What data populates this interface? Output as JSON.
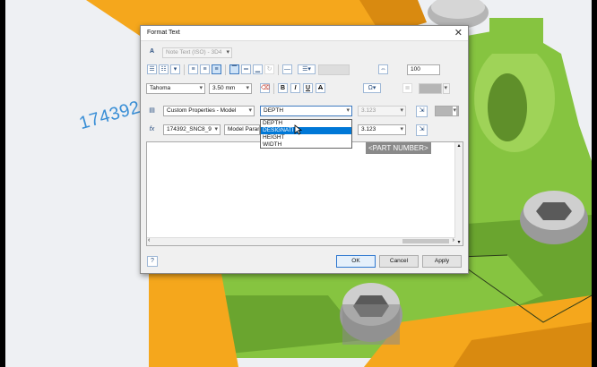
{
  "dialog": {
    "title": "Format Text",
    "close_glyph": "✕",
    "text_style": "Note Text (ISO) - 3D4",
    "font_name": "Tahoma",
    "font_size": "3.50 mm",
    "stretch_pct": "100",
    "bold_glyph": "B",
    "italic_glyph": "I",
    "underline_glyph": "U",
    "strike_glyph": "A",
    "special_glyph": "Ω",
    "source_type": "Custom Properties - Model",
    "property": "DEPTH",
    "precision_1": "3.123",
    "precision_2": "3.123",
    "model_file": "174392_SNC8_9",
    "param_type": "Model Parame",
    "dropdown_items": [
      "DEPTH",
      "DESIGNATI",
      "HEIGHT",
      "WIDTH"
    ],
    "dropdown_selected_index": 1,
    "preview_text": "<PART NUMBER>",
    "ok_label": "OK",
    "cancel_label": "Cancel",
    "apply_label": "Apply",
    "help_glyph": "?",
    "fx_label": "fx"
  },
  "viewport": {
    "dimension_text": "174392"
  },
  "colors": {
    "green_part": "#86c440",
    "orange_part": "#f5a71c",
    "selection_blue": "#0078d7",
    "dimension_blue": "#3a8fd6"
  }
}
